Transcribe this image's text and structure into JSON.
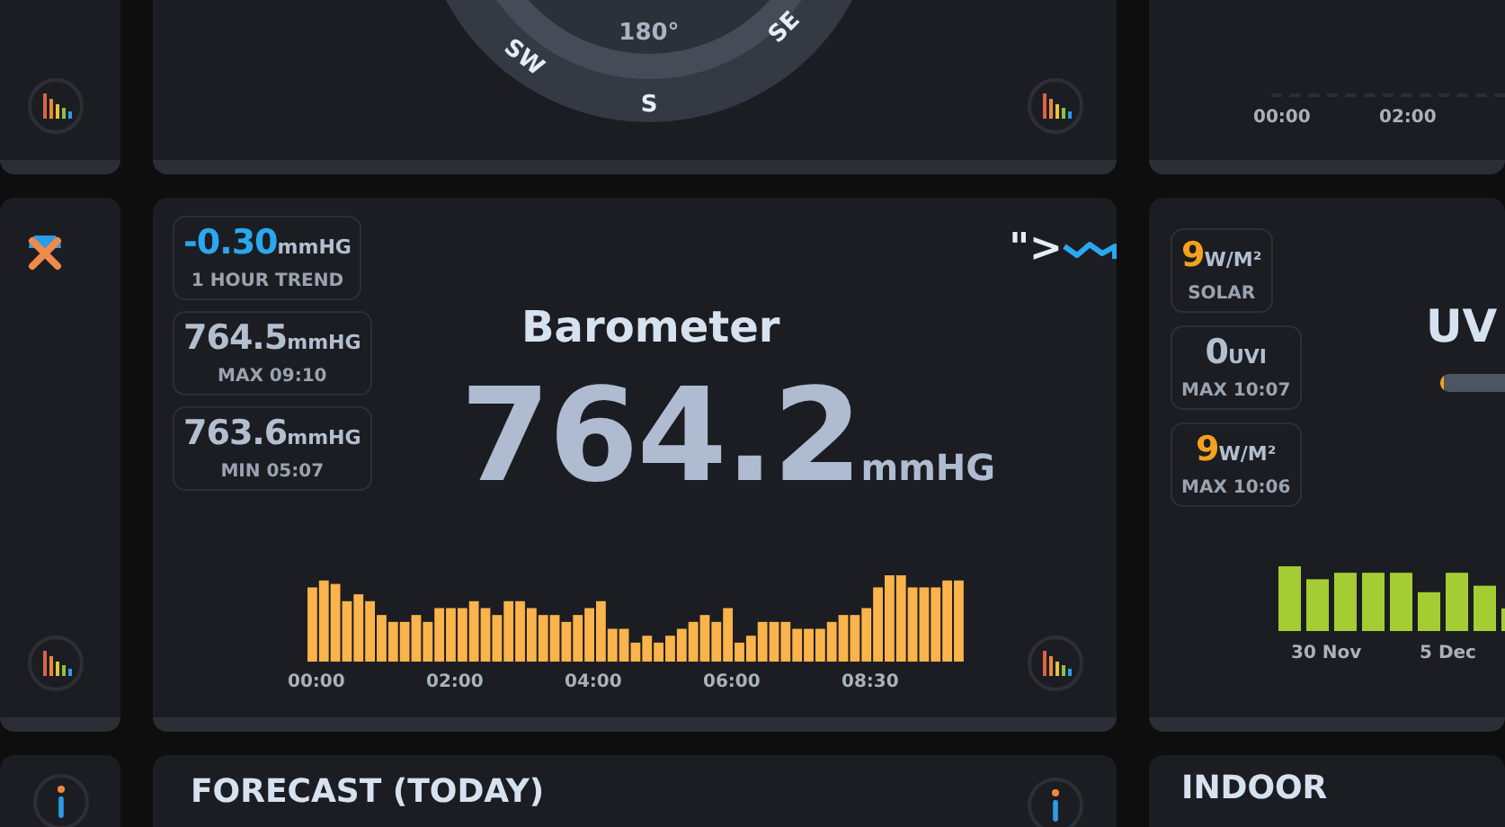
{
  "top_row": {
    "wind": {
      "dial_labels": [
        {
          "text": "180°",
          "kind": "degree"
        },
        {
          "text": "SW",
          "kind": "sw"
        },
        {
          "text": "S",
          "kind": "s"
        },
        {
          "text": "SE",
          "kind": "se"
        }
      ]
    },
    "chart": {
      "x_labels": [
        "00:00",
        "02:00"
      ]
    }
  },
  "barometer": {
    "title": "Barometer",
    "value": "764.2",
    "unit": "mmHG",
    "trend_glyph": "\">",
    "stats": [
      {
        "value": "-0.30",
        "unit": "mmHG",
        "label": "1 HOUR TREND",
        "kind": "trend"
      },
      {
        "value": "764.5",
        "unit": "mmHG",
        "label": "MAX 09:10",
        "kind": "normal"
      },
      {
        "value": "763.6",
        "unit": "mmHG",
        "label": "MIN 05:07",
        "kind": "normal"
      }
    ],
    "x_labels": [
      "00:00",
      "02:00",
      "04:00",
      "06:00",
      "08:30"
    ]
  },
  "solar_uv": {
    "title": "UV",
    "uv_meter": {
      "level": 0.03
    },
    "stats": [
      {
        "value": "9",
        "unit": "W/M²",
        "label": "SOLAR",
        "kind": "solar"
      },
      {
        "value": "0",
        "unit": "UVI",
        "label": "MAX 10:07",
        "kind": "normal"
      },
      {
        "value": "9",
        "unit": "W/M²",
        "label": "MAX 10:06",
        "kind": "solar"
      }
    ],
    "x_labels": [
      "30 Nov",
      "5 Dec"
    ]
  },
  "bottom_row": {
    "forecast_title": "FORECAST (TODAY)",
    "indoor_title": "INDOOR"
  }
}
